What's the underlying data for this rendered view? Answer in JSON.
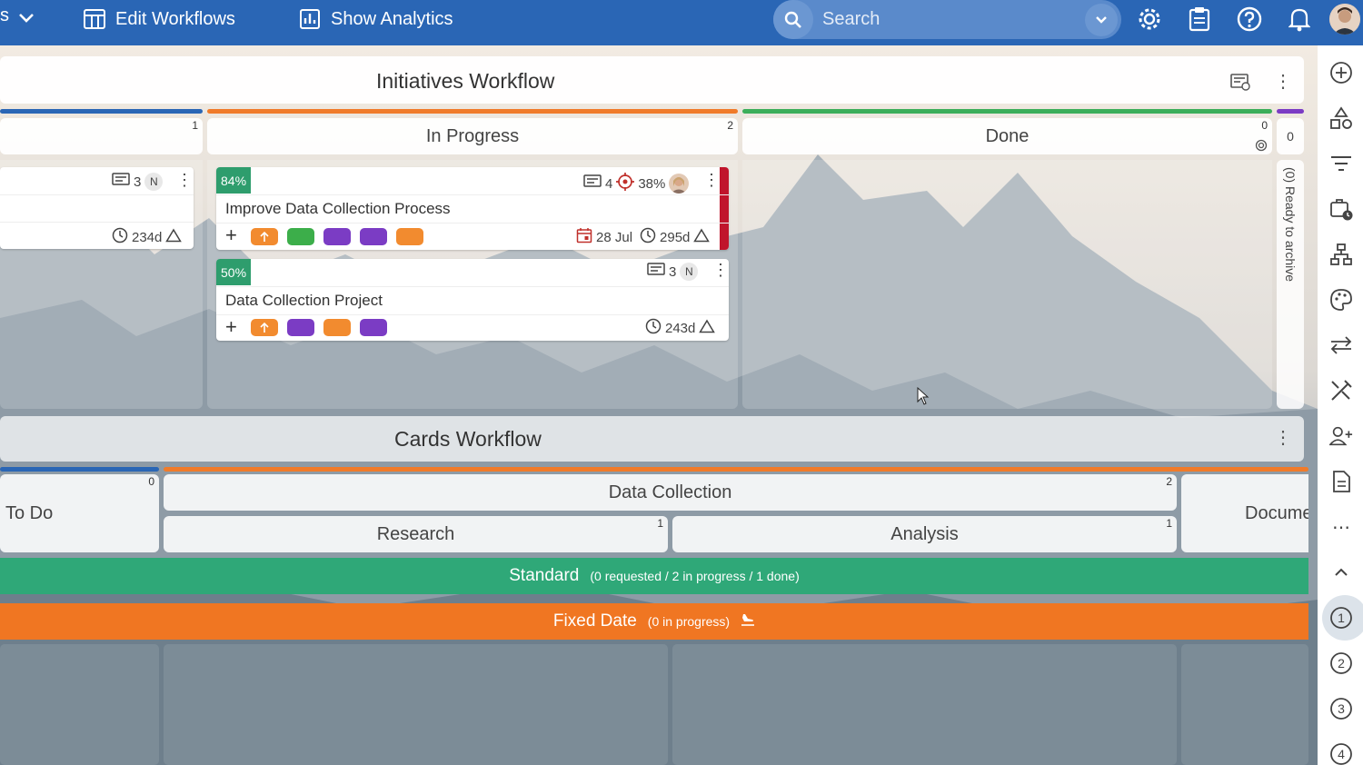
{
  "topbar": {
    "edit_workflows": "Edit Workflows",
    "show_analytics": "Show Analytics",
    "search_placeholder": "Search",
    "left_fragment": "s"
  },
  "initiatives": {
    "title": "Initiatives Workflow",
    "columns": [
      {
        "label": "",
        "count": "1",
        "color": "#2a66b5"
      },
      {
        "label": "In Progress",
        "count": "2",
        "color": "#f07b2a"
      },
      {
        "label": "Done",
        "count": "0",
        "color": "#3cae5a"
      },
      {
        "label": "0",
        "count": "",
        "color": "#7b3cc4"
      }
    ],
    "archive_label": "(0) Ready to archive",
    "partial_card": {
      "comments": "3",
      "initial": "N",
      "age": "234d"
    },
    "cards": [
      {
        "percent": "84%",
        "title": "Improve Data Collection Process",
        "comments": "4",
        "target": "38%",
        "date": "28 Jul",
        "age": "295d",
        "tags": [
          "#f28b2f",
          "#3cae4a",
          "#7b3cc4",
          "#7b3cc4",
          "#f28b2f"
        ]
      },
      {
        "percent": "50%",
        "title": "Data Collection Project",
        "comments": "3",
        "initial": "N",
        "age": "243d",
        "tags": [
          "#f28b2f",
          "#7b3cc4",
          "#f28b2f",
          "#7b3cc4"
        ]
      }
    ]
  },
  "cards_workflow": {
    "title": "Cards Workflow",
    "todo": {
      "label": "To Do",
      "count": "0"
    },
    "data_collection": {
      "label": "Data Collection",
      "count": "2"
    },
    "research": {
      "label": "Research",
      "count": "1"
    },
    "analysis": {
      "label": "Analysis",
      "count": "1"
    },
    "documents": {
      "label": "Docume"
    }
  },
  "lanes": {
    "standard": {
      "title": "Standard",
      "summary": "(0 requested / 2 in progress / 1 done)",
      "color": "#2fa878"
    },
    "fixed": {
      "title": "Fixed Date",
      "summary": "(0 in progress)",
      "color": "#f07622"
    }
  },
  "rail": {
    "icons": [
      "add-icon",
      "shapes-icon",
      "filter-icon",
      "calendar-briefcase-icon",
      "hierarchy-icon",
      "palette-icon",
      "swap-icon",
      "tools-icon",
      "add-user-icon",
      "document-icon",
      "more-icon",
      "collapse-icon",
      "lane-1-icon",
      "lane-2-icon",
      "lane-3-icon",
      "lane-4-icon"
    ],
    "lane_numbers": [
      "1",
      "2",
      "3",
      "4"
    ]
  }
}
